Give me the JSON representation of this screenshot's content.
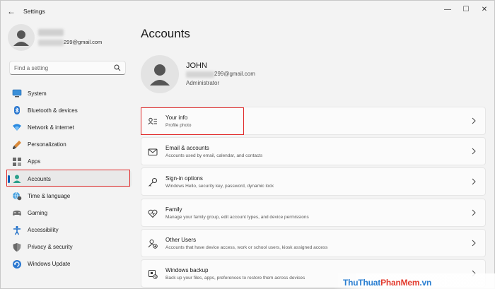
{
  "window": {
    "title": "Settings",
    "back_glyph": "←",
    "minimize_glyph": "—",
    "maximize_glyph": "☐",
    "close_glyph": "✕"
  },
  "sidebar": {
    "user_email_suffix": "299@gmail.com",
    "search_placeholder": "Find a setting",
    "items": [
      {
        "label": "System",
        "icon": "system-icon",
        "active": false
      },
      {
        "label": "Bluetooth & devices",
        "icon": "bluetooth-icon",
        "active": false
      },
      {
        "label": "Network & internet",
        "icon": "wifi-icon",
        "active": false
      },
      {
        "label": "Personalization",
        "icon": "brush-icon",
        "active": false
      },
      {
        "label": "Apps",
        "icon": "apps-icon",
        "active": false
      },
      {
        "label": "Accounts",
        "icon": "account-icon",
        "active": true
      },
      {
        "label": "Time & language",
        "icon": "globe-clock-icon",
        "active": false
      },
      {
        "label": "Gaming",
        "icon": "gamepad-icon",
        "active": false
      },
      {
        "label": "Accessibility",
        "icon": "accessibility-icon",
        "active": false
      },
      {
        "label": "Privacy & security",
        "icon": "shield-icon",
        "active": false
      },
      {
        "label": "Windows Update",
        "icon": "update-icon",
        "active": false
      }
    ]
  },
  "main": {
    "page_title": "Accounts",
    "account": {
      "name": "JOHN",
      "email_suffix": "299@gmail.com",
      "role": "Administrator"
    },
    "cards": [
      {
        "title": "Your info",
        "subtitle": "Profile photo",
        "icon": "person-list-icon"
      },
      {
        "title": "Email & accounts",
        "subtitle": "Accounts used by email, calendar, and contacts",
        "icon": "mail-icon"
      },
      {
        "title": "Sign-in options",
        "subtitle": "Windows Hello, security key, password, dynamic lock",
        "icon": "key-icon"
      },
      {
        "title": "Family",
        "subtitle": "Manage your family group, edit account types, and device permissions",
        "icon": "heart-icon"
      },
      {
        "title": "Other Users",
        "subtitle": "Accounts that have device access, work or school users, kiosk assigned access",
        "icon": "person-add-icon"
      },
      {
        "title": "Windows backup",
        "subtitle": "Back up your files, apps, preferences to restore them across devices",
        "icon": "backup-icon"
      }
    ]
  },
  "watermark": {
    "part1": "ThuThuat",
    "part2": "PhanMem",
    "part3": ".vn"
  },
  "colors": {
    "accent": "#005fb8",
    "highlight": "#e12b2b",
    "background": "#f3f3f3"
  }
}
